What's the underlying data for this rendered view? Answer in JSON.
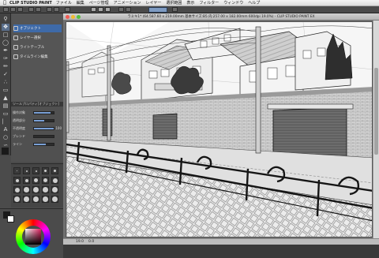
{
  "menubar": {
    "app_name": "CLIP STUDIO PAINT",
    "items": [
      "ファイル",
      "編集",
      "ページ管理",
      "アニメーション",
      "レイヤー",
      "選択範囲",
      "表示",
      "フィルター",
      "ウィンドウ",
      "ヘルプ"
    ]
  },
  "canvas": {
    "document_title": "ラミキ1* (64.587.60 x 219.00mm 基本サイズ:B5 内:257.00 x 182.00mm 600dpi 19.0%) - CLIP STUDIO PAINT EX",
    "zoom": "19.0",
    "angle": "0.0"
  },
  "sub_tools": {
    "items": [
      {
        "label": "オブジェクト",
        "icon": "object-icon",
        "selected": true
      },
      {
        "label": "レイヤー選択",
        "icon": "layer-select-icon",
        "selected": false
      },
      {
        "label": "ライトテーブル",
        "icon": "light-table-icon",
        "selected": false
      },
      {
        "label": "タイムライン編集",
        "icon": "timeline-icon",
        "selected": false
      }
    ]
  },
  "tool_property": {
    "header": "ツールプロパティ[オブジェクト]",
    "rows": [
      {
        "label": "操作対象",
        "value": "",
        "level": 0.85
      },
      {
        "label": "透明部分",
        "value": "",
        "level": 0.5
      },
      {
        "label": "不透明度",
        "value": "100",
        "level": 1.0
      },
      {
        "label": "ブレンド",
        "value": "",
        "level": 0.0
      },
      {
        "label": "ライン",
        "value": "",
        "level": 0.6
      }
    ]
  },
  "colors": {
    "main": "#1a1a1a",
    "sub": "#ffffff",
    "accent": "#3e6aa8",
    "mode_button": "#7e9bc2"
  },
  "tools": [
    "zoom-icon",
    "move-icon",
    "select-icon",
    "lasso-icon",
    "eyedropper-icon",
    "pen-icon",
    "pencil-icon",
    "brush-icon",
    "airbrush-icon",
    "eraser-icon",
    "fill-icon",
    "gradient-icon",
    "figure-icon",
    "ruler-icon",
    "text-icon",
    "balloon-icon",
    "correct-line-icon"
  ]
}
